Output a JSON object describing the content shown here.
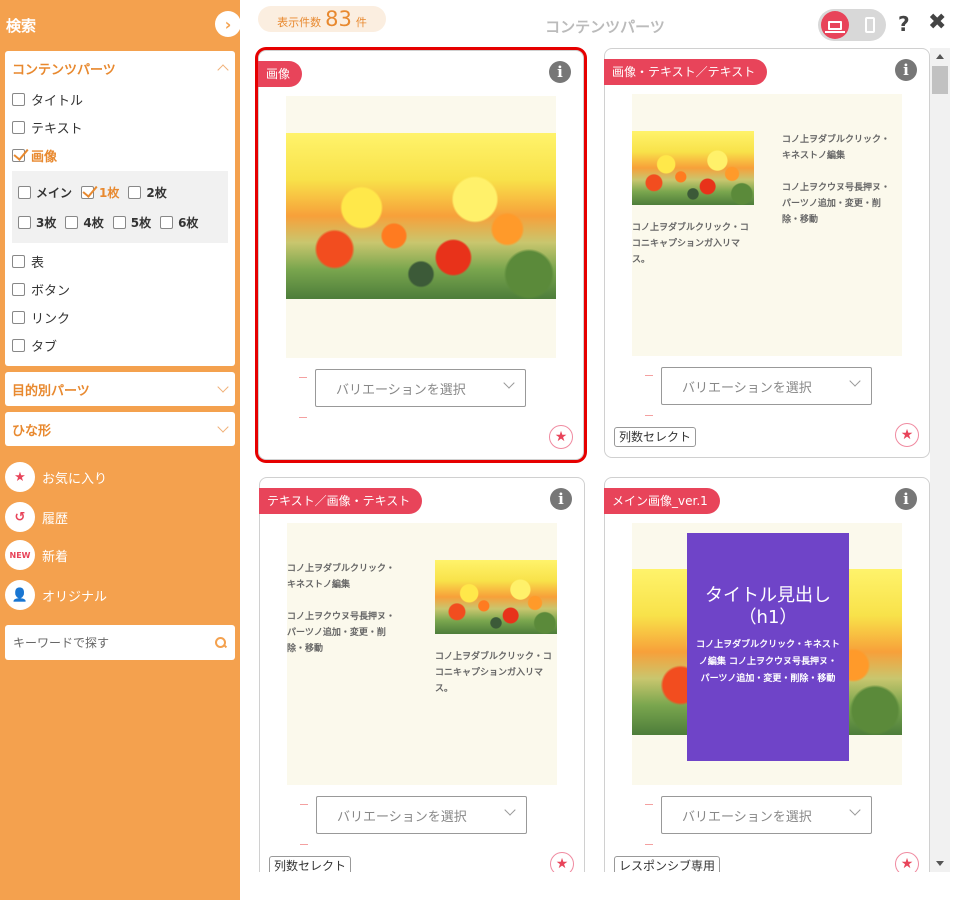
{
  "sidebar": {
    "title": "検索",
    "sections": {
      "content_parts": "コンテンツパーツ",
      "purpose_parts": "目的別パーツ",
      "templates": "ひな形"
    },
    "filters": {
      "title": "タイトル",
      "text": "テキスト",
      "image": "画像",
      "table": "表",
      "button": "ボタン",
      "link": "リンク",
      "tab": "タブ"
    },
    "image_options": {
      "main": "メイン",
      "one": "1枚",
      "two": "2枚",
      "three": "3枚",
      "four": "4枚",
      "five": "5枚",
      "six": "6枚"
    },
    "nav": {
      "favorites": "お気に入り",
      "history": "履歴",
      "new_badge": "NEW",
      "new": "新着",
      "original": "オリジナル"
    },
    "search_placeholder": "キーワードで探す"
  },
  "topbar": {
    "count_label": "表示件数",
    "count_value": "83",
    "count_unit": "件",
    "title": "コンテンツパーツ"
  },
  "cards": [
    {
      "tag": "画像",
      "variation": "バリエーションを選択"
    },
    {
      "tag": "画像・テキスト／テキスト",
      "variation": "バリエーションを選択",
      "chip": "列数セレクト",
      "text_a": "コノ上ヲダブルクリック・キネストノ編集",
      "text_b": "コノ上ヲクウヌ号長押ヌ・パーツノ追加・変更・削除・移動",
      "text_c": "コノ上ヲダブルクリック・ココニキャプションガ入リマス。"
    },
    {
      "tag": "テキスト／画像・テキスト",
      "variation": "バリエーションを選択",
      "chip": "列数セレクト",
      "text_a": "コノ上ヲダブルクリック・キネストノ編集",
      "text_b": "コノ上ヲクウヌ号長押ヌ・パーツノ追加・変更・削除・移動",
      "text_c": "コノ上ヲダブルクリック・ココニキャプションガ入リマス。"
    },
    {
      "tag": "メイン画像_ver.1",
      "variation": "バリエーションを選択",
      "chip": "レスポンシブ専用",
      "hero_title": "タイトル見出し（h1）",
      "hero_text": "コノ上ヲダブルクリック・キネストノ編集 コノ上ヲクウヌ号長押ヌ・パーツノ追加・変更・削除・移動"
    }
  ],
  "colors": {
    "sidebar": "#f4a14e",
    "accent": "#e8445a",
    "purple": "#6f44c8"
  }
}
